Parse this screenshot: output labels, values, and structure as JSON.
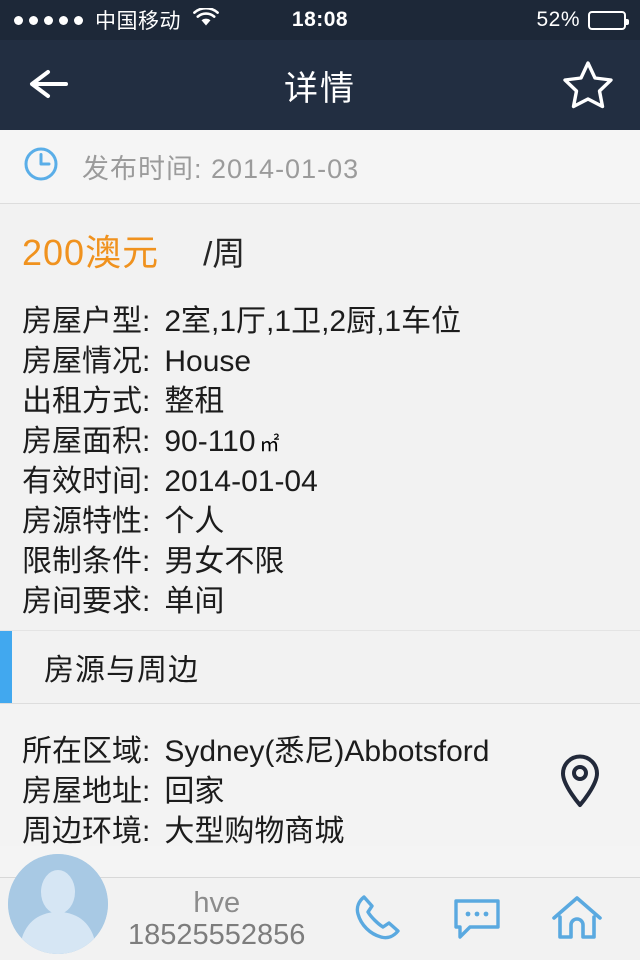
{
  "status_bar": {
    "signal_dots": 5,
    "carrier": "中国移动",
    "wifi_icon": "wifi-icon",
    "time": "18:08",
    "battery_percent": "52%",
    "battery_level": 52,
    "background_color": "#1d2838"
  },
  "nav_bar": {
    "back_icon": "back-arrow-icon",
    "title": "详情",
    "favorite_icon": "star-outline-icon",
    "background_color": "#222e41"
  },
  "publish": {
    "clock_icon": "clock-icon",
    "label": "发布时间:",
    "date": "2014-01-03",
    "text": "发布时间: 2014-01-03",
    "icon_color": "#5aaee8"
  },
  "price": {
    "amount": "200澳元",
    "unit": "/周",
    "color": "#f0921e"
  },
  "specs": [
    {
      "label": "房屋户型:",
      "value": "2室,1厅,1卫,2厨,1车位"
    },
    {
      "label": "房屋情况:",
      "value": "House"
    },
    {
      "label": "出租方式:",
      "value": "整租"
    },
    {
      "label": "房屋面积:",
      "value": "90-110",
      "unit": "㎡"
    },
    {
      "label": "有效时间:",
      "value": "2014-01-04"
    },
    {
      "label": "房源特性:",
      "value": "个人"
    },
    {
      "label": "限制条件:",
      "value": "男女不限"
    },
    {
      "label": "房间要求:",
      "value": "单间"
    }
  ],
  "section": {
    "title": "房源与周边",
    "accent_color": "#41a8ef"
  },
  "location": {
    "rows": [
      {
        "label": "所在区域:",
        "value": "Sydney(悉尼)Abbotsford"
      },
      {
        "label": "房屋地址:",
        "value": "回家"
      },
      {
        "label": "周边环境:",
        "value": "大型购物商城"
      }
    ],
    "map_pin_icon": "map-pin-icon"
  },
  "bottom_bar": {
    "avatar_icon": "avatar-person-icon",
    "contact_name": "hve",
    "contact_phone": "18525552856",
    "actions": [
      {
        "icon": "phone-icon"
      },
      {
        "icon": "message-icon"
      },
      {
        "icon": "home-icon"
      }
    ],
    "icon_color": "#5aa9e0"
  }
}
